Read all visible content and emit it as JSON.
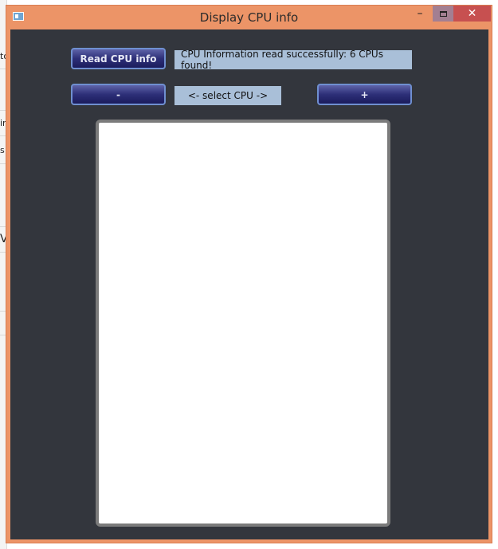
{
  "window": {
    "title": "Display CPU info",
    "controls": {
      "minimize_glyph": "–",
      "close_glyph": "✕"
    }
  },
  "background_app": {
    "fragments": [
      "to",
      "in",
      "s",
      "V"
    ]
  },
  "toolbar": {
    "read_button_label": "Read CPU info",
    "status_text": "CPU Information read successfully: 6 CPUs found!",
    "prev_button_label": "-",
    "select_label": "<- select CPU ->",
    "next_button_label": "+"
  },
  "info_pane": {
    "content": ""
  },
  "colors": {
    "frame": "#ec9467",
    "client_bg": "#33363d",
    "button_top": "#5e63a8",
    "button_bottom": "#1b1c5c",
    "label_bg": "#a9bfd8",
    "close_bg": "#c75050"
  }
}
